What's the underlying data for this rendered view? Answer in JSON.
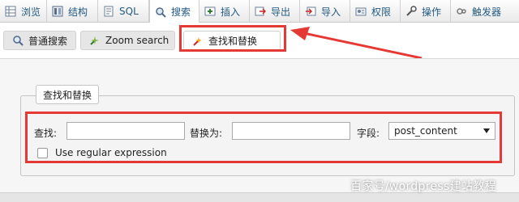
{
  "tabs": [
    {
      "label": "浏览",
      "icon": "browse-icon"
    },
    {
      "label": "结构",
      "icon": "structure-icon"
    },
    {
      "label": "SQL",
      "icon": "sql-icon"
    },
    {
      "label": "搜索",
      "icon": "search-icon"
    },
    {
      "label": "插入",
      "icon": "insert-icon"
    },
    {
      "label": "导出",
      "icon": "export-icon"
    },
    {
      "label": "导入",
      "icon": "import-icon"
    },
    {
      "label": "权限",
      "icon": "privileges-icon"
    },
    {
      "label": "操作",
      "icon": "operations-icon"
    },
    {
      "label": "触发器",
      "icon": "triggers-icon"
    }
  ],
  "active_tab": "搜索",
  "subtabs": {
    "normal": "普通搜索",
    "zoom": "Zoom search",
    "replace": "查找和替换"
  },
  "form": {
    "legend": "查找和替换",
    "find_label": "查找:",
    "find_value": "",
    "replace_label": "替换为:",
    "replace_value": "",
    "column_label": "字段:",
    "column_selected": "post_content",
    "regex_label": "Use regular expression",
    "regex_checked": false
  },
  "watermark": "百家号/wordpress建站教程",
  "colors": {
    "annotation_red": "#e53935",
    "link_blue": "#235a81"
  }
}
